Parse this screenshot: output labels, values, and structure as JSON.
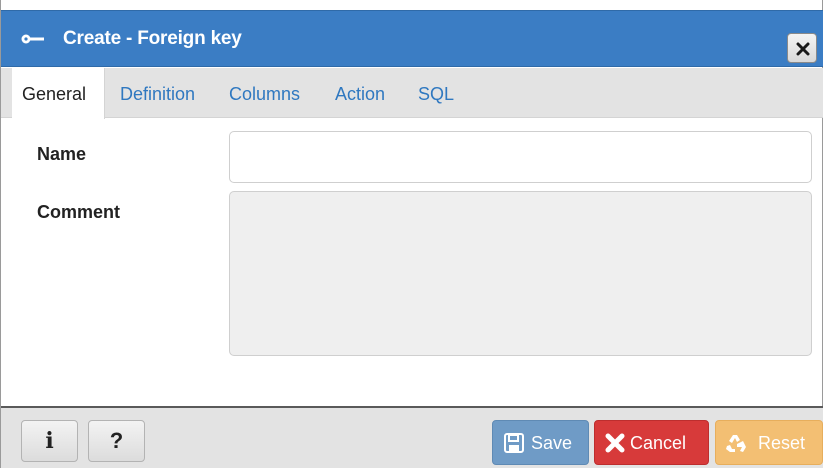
{
  "dialog": {
    "title": "Create - Foreign key",
    "title_icon": "key-icon",
    "close_icon": "close-icon"
  },
  "tabs": [
    {
      "label": "General",
      "active": true
    },
    {
      "label": "Definition",
      "active": false
    },
    {
      "label": "Columns",
      "active": false
    },
    {
      "label": "Action",
      "active": false
    },
    {
      "label": "SQL",
      "active": false
    }
  ],
  "form": {
    "name_label": "Name",
    "name_value": "",
    "comment_label": "Comment",
    "comment_value": ""
  },
  "footer": {
    "info_label": "i",
    "help_label": "?",
    "save_label": "Save",
    "cancel_label": "Cancel",
    "reset_label": "Reset"
  },
  "colors": {
    "titlebar": "#3b7dc4",
    "save": "#6f9bc6",
    "cancel": "#d73a3a",
    "reset": "#f3bf73",
    "tab_link": "#2f78c0"
  }
}
